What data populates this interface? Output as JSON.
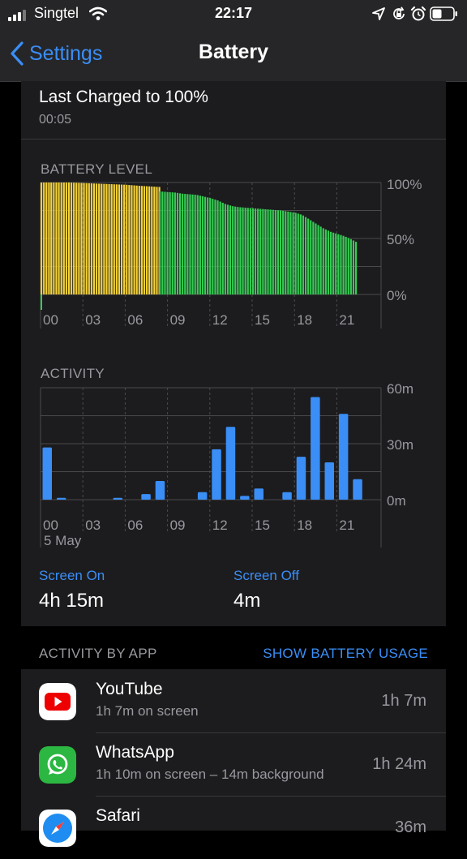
{
  "status_bar": {
    "carrier": "Singtel",
    "time": "22:17"
  },
  "nav": {
    "back_label": "Settings",
    "title": "Battery"
  },
  "last_charged": {
    "title": "Last Charged to 100%",
    "time": "00:05"
  },
  "battery_chart": {
    "label": "BATTERY LEVEL",
    "y_tick_labels": [
      "100%",
      "50%",
      "0%"
    ],
    "x_tick_labels": [
      "00",
      "03",
      "06",
      "09",
      "12",
      "15",
      "18",
      "21"
    ]
  },
  "activity_chart": {
    "label": "ACTIVITY",
    "y_tick_labels": [
      "60m",
      "30m",
      "0m"
    ],
    "x_tick_labels": [
      "00",
      "03",
      "06",
      "09",
      "12",
      "15",
      "18",
      "21"
    ],
    "date_label": "5 May"
  },
  "chart_data": [
    {
      "type": "bar",
      "title": "BATTERY LEVEL",
      "x_unit": "hour",
      "ylim": [
        0,
        100
      ],
      "y_unit": "%",
      "colors": {
        "charging": "#f5d33a",
        "battery": "#35cc53",
        "grid": "#4a4a4c"
      },
      "series": [
        {
          "color": "charging",
          "hour_range": [
            0.0,
            0.7
          ],
          "hours": [
            0.0,
            0.7
          ],
          "values": [
            100,
            100
          ]
        },
        {
          "color": "charging",
          "hour_range": [
            0.7,
            8.4
          ],
          "hours": [
            0.7,
            2.0,
            4.0,
            6.0,
            7.0,
            8.4
          ],
          "values": [
            100,
            100,
            99,
            98,
            97,
            96
          ]
        },
        {
          "color": "battery",
          "hour_range": [
            8.4,
            22.3
          ],
          "hours": [
            8.4,
            9.5,
            10.0,
            11.0,
            12.0,
            12.5,
            13.0,
            13.5,
            14.0,
            15.0,
            16.0,
            17.0,
            18.0,
            18.5,
            19.0,
            19.5,
            20.0,
            20.5,
            21.0,
            21.5,
            22.0,
            22.3
          ],
          "values": [
            92,
            91,
            90,
            89,
            86,
            84,
            81,
            79,
            78,
            77,
            76,
            75,
            73,
            71,
            67,
            63,
            59,
            56,
            54,
            52,
            49,
            47
          ]
        }
      ]
    },
    {
      "type": "bar",
      "title": "ACTIVITY",
      "x_unit": "hour",
      "ylim": [
        0,
        60
      ],
      "y_unit": "minutes",
      "color": "#3a8ef6",
      "hours": [
        0,
        1,
        2,
        3,
        4,
        5,
        6,
        7,
        8,
        9,
        10,
        11,
        12,
        13,
        14,
        15,
        16,
        17,
        18,
        19,
        20,
        21,
        22
      ],
      "values": [
        28,
        1,
        0,
        0,
        0,
        1,
        0,
        3,
        10,
        0,
        0,
        4,
        27,
        39,
        2,
        6,
        0,
        4,
        23,
        55,
        20,
        46,
        11
      ]
    }
  ],
  "screen_on": {
    "label": "Screen On",
    "value": "4h 15m"
  },
  "screen_off": {
    "label": "Screen Off",
    "value": "4m"
  },
  "activity_by_app": {
    "label": "ACTIVITY BY APP",
    "link": "SHOW BATTERY USAGE"
  },
  "apps": [
    {
      "name": "YouTube",
      "detail": "1h 7m on screen",
      "time": "1h 7m",
      "icon": "youtube-icon"
    },
    {
      "name": "WhatsApp",
      "detail": "1h 10m on screen – 14m background",
      "time": "1h 24m",
      "icon": "whatsapp-icon"
    },
    {
      "name": "Safari",
      "detail": "",
      "time": "36m",
      "icon": "safari-icon"
    }
  ]
}
